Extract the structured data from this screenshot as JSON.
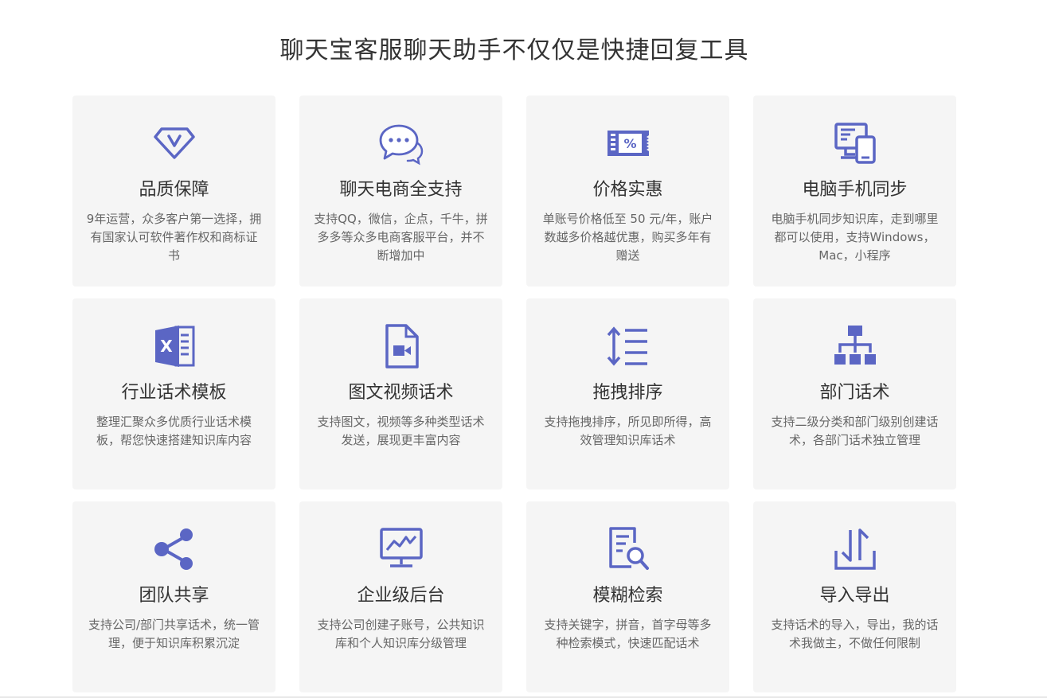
{
  "heading": "聊天宝客服聊天助手不仅仅是快捷回复工具",
  "accent_color": "#5b66c4",
  "cards": [
    {
      "icon": "diamond-v-icon",
      "title": "品质保障",
      "desc": "9年运营，众多客户第一选择，拥有国家认可软件著作权和商标证书"
    },
    {
      "icon": "chat-bubbles-icon",
      "title": "聊天电商全支持",
      "desc": "支持QQ，微信，企点，千牛，拼多多等众多电商客服平台，并不断增加中"
    },
    {
      "icon": "discount-ticket-icon",
      "title": "价格实惠",
      "desc": "单账号价格低至 50 元/年，账户数越多价格越优惠，购买多年有赠送"
    },
    {
      "icon": "computer-phone-icon",
      "title": "电脑手机同步",
      "desc": "电脑手机同步知识库，走到哪里都可以使用，支持Windows，Mac，小程序"
    },
    {
      "icon": "excel-icon",
      "title": "行业话术模板",
      "desc": "整理汇聚众多优质行业话术模板，帮您快速搭建知识库内容"
    },
    {
      "icon": "video-file-icon",
      "title": "图文视频话术",
      "desc": "支持图文，视频等多种类型话术发送，展现更丰富内容"
    },
    {
      "icon": "sort-list-icon",
      "title": "拖拽排序",
      "desc": "支持拖拽排序，所见即所得，高效管理知识库话术"
    },
    {
      "icon": "org-chart-icon",
      "title": "部门话术",
      "desc": "支持二级分类和部门级别创建话术，各部门话术独立管理"
    },
    {
      "icon": "share-icon",
      "title": "团队共享",
      "desc": "支持公司/部门共享话术，统一管理，便于知识库积累沉淀"
    },
    {
      "icon": "monitor-chart-icon",
      "title": "企业级后台",
      "desc": "支持公司创建子账号，公共知识库和个人知识库分级管理"
    },
    {
      "icon": "document-search-icon",
      "title": "模糊检索",
      "desc": "支持关键字，拼音，首字母等多种检索模式，快速匹配话术"
    },
    {
      "icon": "import-export-icon",
      "title": "导入导出",
      "desc": "支持话术的导入，导出，我的话术我做主，不做任何限制"
    }
  ]
}
